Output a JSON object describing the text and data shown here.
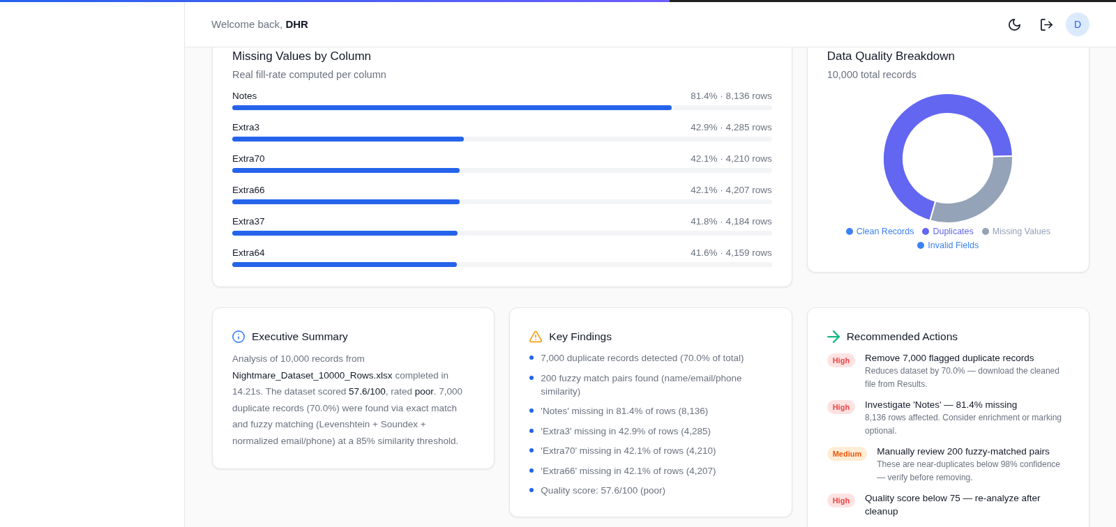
{
  "loading_bar": {
    "level": 0.6
  },
  "header": {
    "welcome": "Welcome back, **DHR**",
    "avatar": "D"
  },
  "missing_values": {
    "title": "Missing Values by Column",
    "subtitle": "Real fill-rate computed per column",
    "columns": [
      {
        "name": "Notes",
        "reading": "81.4% · 8,136 rows",
        "level": 0.814
      },
      {
        "name": "Extra3",
        "reading": "42.9% · 4,285 rows",
        "level": 0.429
      },
      {
        "name": "Extra70",
        "reading": "42.1% · 4,210 rows",
        "level": 0.421
      },
      {
        "name": "Extra66",
        "reading": "42.1% · 4,207 rows",
        "level": 0.421
      },
      {
        "name": "Extra37",
        "reading": "41.8% · 4,184 rows",
        "level": 0.418
      },
      {
        "name": "Extra64",
        "reading": "41.6% · 4,159 rows",
        "level": 0.416
      }
    ]
  },
  "quality_breakdown": {
    "title": "Data Quality Breakdown",
    "subtitle": "10,000 total records",
    "legend": [
      {
        "label": "Clean Records",
        "color": "#3b82f6"
      },
      {
        "label": "Duplicates",
        "color": "#6366f1"
      },
      {
        "label": "Missing Values",
        "color": "#94a3b8"
      },
      {
        "label": "Invalid Fields",
        "color": "#3b82f6"
      }
    ]
  },
  "executive_summary": {
    "title": "Executive Summary",
    "text": "Analysis of 10,000 records from **Nightmare_Dataset_10000_Rows.xlsx** completed in 14.21s. The dataset scored **57.6/100**, rated **poor**. 7,000 duplicate records (70.0%) were found via exact match and fuzzy matching (Levenshtein + Soundex + normalized email/phone) at a 85% similarity threshold."
  },
  "key_findings": {
    "title": "Key Findings",
    "items": [
      "7,000 duplicate records detected (70.0% of total)",
      "200 fuzzy match pairs found (name/email/phone similarity)",
      "'Notes' missing in 81.4% of rows (8,136)",
      "'Extra3' missing in 42.9% of rows (4,285)",
      "'Extra70' missing in 42.1% of rows (4,210)",
      "'Extra66' missing in 42.1% of rows (4,207)",
      "Quality score: 57.6/100 (poor)"
    ]
  },
  "recommended_actions": {
    "title": "Recommended Actions",
    "items": [
      {
        "priority": "High",
        "kind": "high",
        "title": "Remove 7,000 flagged duplicate records",
        "detail": "Reduces dataset by 70.0% — download the cleaned file from Results."
      },
      {
        "priority": "High",
        "kind": "high",
        "title": "Investigate 'Notes' — 81.4% missing",
        "detail": "8,136 rows affected. Consider enrichment or marking optional."
      },
      {
        "priority": "Medium",
        "kind": "medium",
        "title": "Manually review 200 fuzzy-matched pairs",
        "detail": "These are near-duplicates below 98% confidence — verify before removing."
      },
      {
        "priority": "High",
        "kind": "high",
        "title": "Quality score below 75 — re-analyze after cleanup"
      }
    ]
  }
}
